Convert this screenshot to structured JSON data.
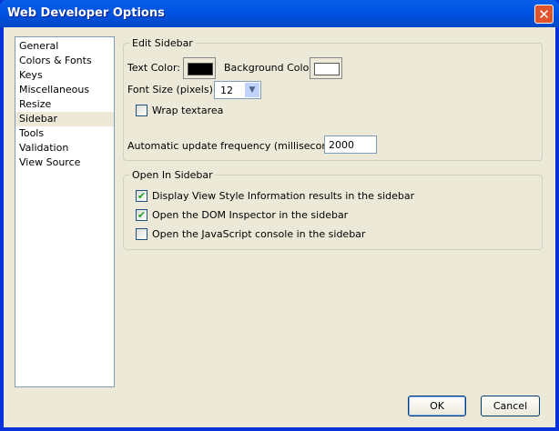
{
  "window": {
    "title": "Web Developer Options"
  },
  "sidebar": {
    "items": [
      "General",
      "Colors & Fonts",
      "Keys",
      "Miscellaneous",
      "Resize",
      "Sidebar",
      "Tools",
      "Validation",
      "View Source"
    ],
    "selected": "Sidebar"
  },
  "edit_sidebar": {
    "legend": "Edit Sidebar",
    "text_color_label": "Text Color:",
    "text_color": "#000000",
    "bg_color_label": "Background Color:",
    "bg_color": "#ffffff",
    "font_size_label": "Font Size (pixels):",
    "font_size": "12",
    "wrap_label": "Wrap textarea",
    "wrap_checked": false,
    "update_label": "Automatic update frequency (milliseconds):",
    "update_value": "2000"
  },
  "open_in_sidebar": {
    "legend": "Open In Sidebar",
    "options": [
      {
        "label": "Display View Style Information results in the sidebar",
        "checked": true
      },
      {
        "label": "Open the DOM Inspector in the sidebar",
        "checked": true
      },
      {
        "label": "Open the JavaScript console in the sidebar",
        "checked": false
      }
    ]
  },
  "buttons": {
    "ok": "OK",
    "cancel": "Cancel"
  }
}
